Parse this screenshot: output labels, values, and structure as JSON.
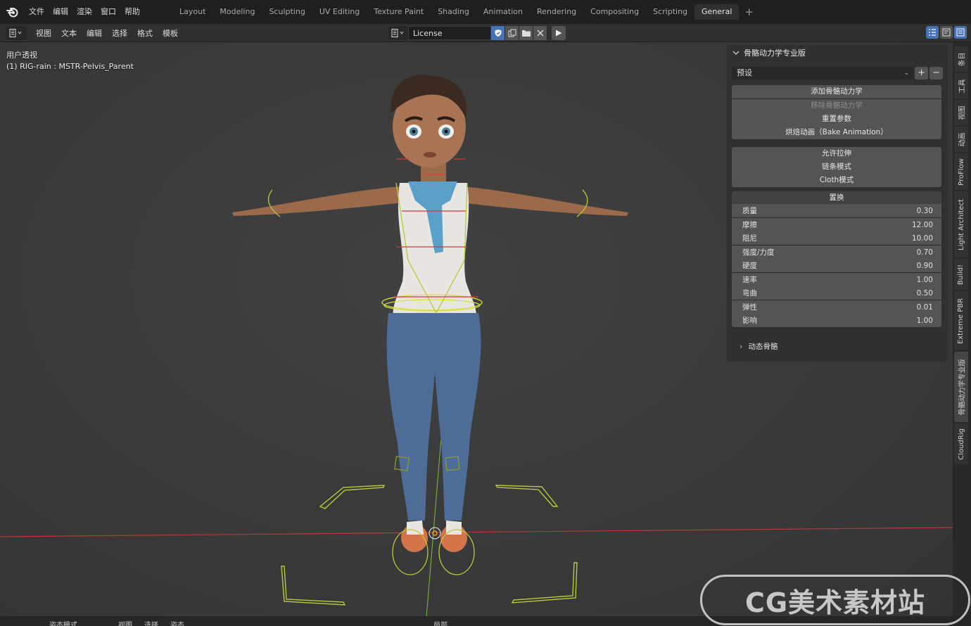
{
  "top_menu": {
    "logo_icon": "blender-logo-icon",
    "items": [
      "文件",
      "编辑",
      "渲染",
      "窗口",
      "帮助"
    ]
  },
  "workspaces": {
    "tabs": [
      "Layout",
      "Modeling",
      "Sculpting",
      "UV Editing",
      "Texture Paint",
      "Shading",
      "Animation",
      "Rendering",
      "Compositing",
      "Scripting",
      "General"
    ],
    "active": "General",
    "add_label": "+"
  },
  "text_editor": {
    "menu": [
      "视图",
      "文本",
      "编辑",
      "选择",
      "格式",
      "模板"
    ],
    "document_name": "License"
  },
  "viewport": {
    "mode_label": "用户透视",
    "object_label": "(1) RIG-rain : MSTR-Pelvis_Parent"
  },
  "panel": {
    "title": "骨骼动力学专业版",
    "preset": "预设",
    "buttons_group1": [
      {
        "label": "添加骨骼动力学",
        "enabled": true
      },
      {
        "label": "移除骨骼动力学",
        "enabled": false
      },
      {
        "label": "重置参数",
        "enabled": true
      },
      {
        "label": "烘焙动画（Bake Animation）",
        "enabled": true
      }
    ],
    "buttons_group2": [
      "允许拉伸",
      "链条模式",
      "Cloth模式"
    ],
    "section_header": "置换",
    "properties": [
      {
        "label": "质量",
        "value": "0.30"
      },
      {
        "label": "摩擦",
        "value": "12.00"
      },
      {
        "label": "阻尼",
        "value": "10.00"
      },
      {
        "label": "强度/力度",
        "value": "0.70"
      },
      {
        "label": "硬度",
        "value": "0.90"
      },
      {
        "label": "速率",
        "value": "1.00"
      },
      {
        "label": "弯曲",
        "value": "0.50"
      },
      {
        "label": "弹性",
        "value": "0.01"
      },
      {
        "label": "影响",
        "value": "1.00"
      }
    ],
    "subpanel": "动态骨骼"
  },
  "side_tabs": [
    "条目",
    "工具",
    "视图",
    "动画",
    "ProFlow",
    "Light Architect",
    "Build!",
    "Extreme PBR",
    "骨骼动力学专业版",
    "CloudRig"
  ],
  "side_tabs_active": "骨骼动力学专业版",
  "bottom_bar": {
    "mode": "姿态模式",
    "menu": [
      "视图",
      "选择",
      "姿态"
    ],
    "pivot": "局部"
  },
  "watermark": "CG美术素材站",
  "colors": {
    "accent": "#4772b3",
    "rig_wire": "#b9c93a",
    "x_axis": "#c83a3a",
    "y_axis": "#7bbd3a"
  }
}
